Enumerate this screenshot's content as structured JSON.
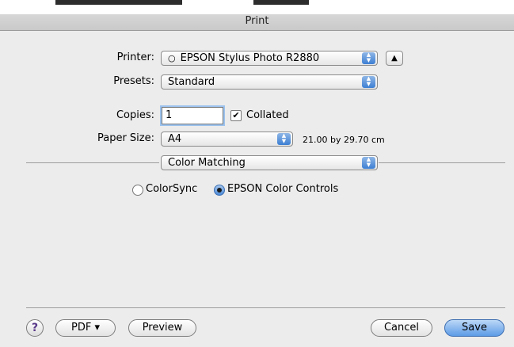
{
  "window": {
    "title": "Print"
  },
  "printer": {
    "label": "Printer:",
    "value": "EPSON Stylus Photo R2880"
  },
  "presets": {
    "label": "Presets:",
    "value": "Standard"
  },
  "copies": {
    "label": "Copies:",
    "value": "1",
    "collated_label": "Collated",
    "collated": true
  },
  "paper_size": {
    "label": "Paper Size:",
    "value": "A4",
    "dimensions": "21.00 by 29.70 cm"
  },
  "panel": {
    "value": "Color Matching"
  },
  "color_mode": {
    "options": [
      "ColorSync",
      "EPSON Color Controls"
    ],
    "selected": "EPSON Color Controls"
  },
  "footer": {
    "help_label": "?",
    "pdf_label": "PDF ▾",
    "preview_label": "Preview",
    "cancel_label": "Cancel",
    "save_label": "Save"
  }
}
